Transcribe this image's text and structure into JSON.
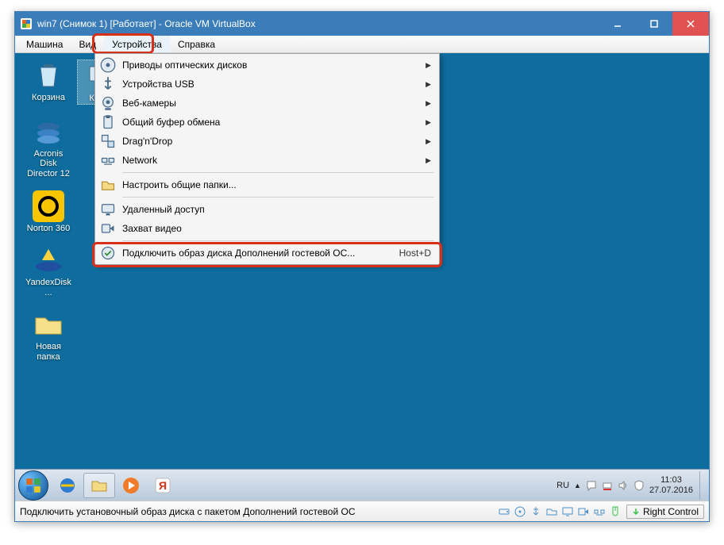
{
  "window": {
    "title": "win7 (Снимок 1) [Работает] - Oracle VM VirtualBox"
  },
  "menubar": {
    "items": [
      "Машина",
      "Вид",
      "Устройства",
      "Справка"
    ],
    "active_index": 2
  },
  "devices_menu": [
    {
      "icon": "disc-icon",
      "label": "Приводы оптических дисков",
      "submenu": true
    },
    {
      "icon": "usb-icon",
      "label": "Устройства USB",
      "submenu": true
    },
    {
      "icon": "webcam-icon",
      "label": "Веб-камеры",
      "submenu": true
    },
    {
      "icon": "clipboard-icon",
      "label": "Общий буфер обмена",
      "submenu": true
    },
    {
      "icon": "drag-icon",
      "label": "Drag'n'Drop",
      "submenu": true
    },
    {
      "icon": "network-icon",
      "label": "Network",
      "submenu": true
    },
    {
      "sep": true
    },
    {
      "icon": "folder-icon",
      "label": "Настроить общие папки...",
      "submenu": false
    },
    {
      "sep": true
    },
    {
      "icon": "remote-icon",
      "label": "Удаленный доступ",
      "submenu": false
    },
    {
      "icon": "capture-icon",
      "label": "Захват видео",
      "submenu": false
    },
    {
      "sep": true
    },
    {
      "icon": "guest-add-icon",
      "label": "Подключить образ диска Дополнений гостевой ОС...",
      "submenu": false,
      "shortcut": "Host+D",
      "highlight": true
    }
  ],
  "desktop": {
    "icons": [
      {
        "name": "recycle-bin",
        "label": "Корзина"
      },
      {
        "name": "computer",
        "label": "Ком..."
      },
      {
        "name": "acronis",
        "label": "Acronis Disk Director 12"
      },
      {
        "name": "norton",
        "label": "Norton 360"
      },
      {
        "name": "yandexdisk",
        "label": "YandexDisk..."
      },
      {
        "name": "new-folder",
        "label": "Новая папка"
      }
    ]
  },
  "taskbar": {
    "pinned": [
      "ie",
      "explorer",
      "wmp",
      "yandex"
    ],
    "tray_lang": "RU",
    "clock_time": "11:03",
    "clock_date": "27.07.2016"
  },
  "statusbar": {
    "message": "Подключить установочный образ диска с пакетом Дополнений гостевой ОС",
    "host_key": "Right Control",
    "indicator_icons": [
      "hdd",
      "disc",
      "usb",
      "folder",
      "monitor",
      "camera",
      "net",
      "mouse"
    ]
  },
  "colors": {
    "accent": "#3a7db9",
    "highlight": "#d6301a",
    "desktop_bg": "#0e6d9e"
  }
}
